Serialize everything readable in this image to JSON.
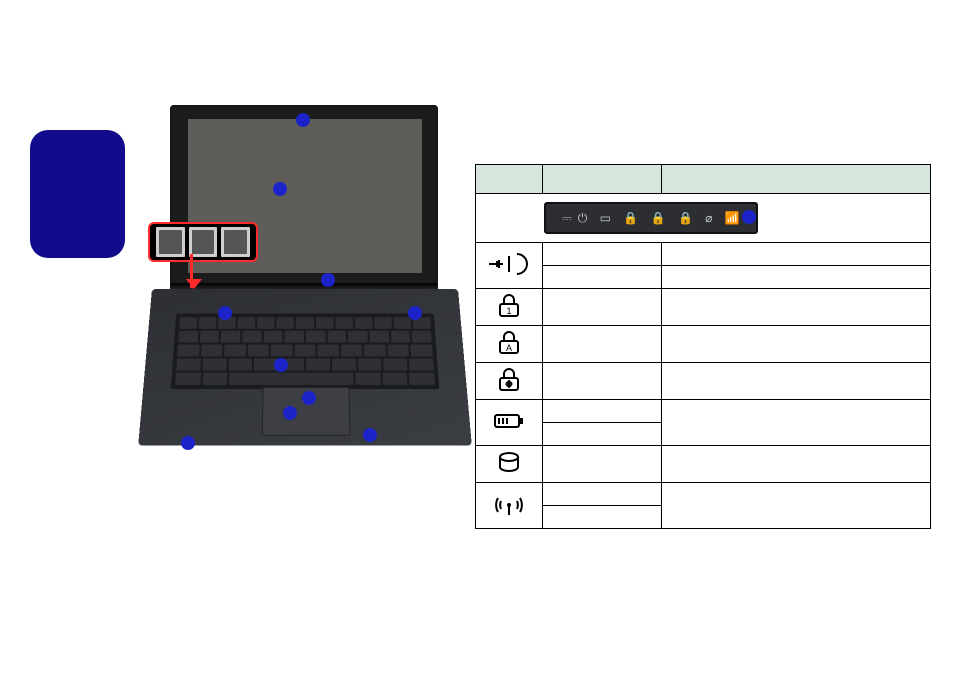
{
  "blue_card": {},
  "laptop_callouts": [
    "camera",
    "display",
    "led-panel-area",
    "power-button",
    "hotkey-area",
    "keyboard-area",
    "touchpad",
    "click-buttons",
    "palmrest"
  ],
  "hotkey_inset": {
    "buttons": [
      "hk-1",
      "hk-2",
      "hk-3"
    ]
  },
  "led_strip_icons": [
    "ac-power-icon",
    "power-icon",
    "battery-icon",
    "numlock-icon",
    "capslock-icon",
    "scrolllock-icon",
    "hdd-icon",
    "wireless-icon"
  ],
  "led_table": {
    "headers": [
      "",
      "",
      ""
    ],
    "rows": [
      {
        "icon": "ac-power-combo-icon",
        "col1": [
          "",
          ""
        ],
        "col2": [
          "",
          ""
        ]
      },
      {
        "icon": "numlock-icon",
        "col1": [
          ""
        ],
        "col2": [
          ""
        ]
      },
      {
        "icon": "capslock-icon",
        "col1": [
          ""
        ],
        "col2": [
          ""
        ]
      },
      {
        "icon": "scrolllock-icon",
        "col1": [
          ""
        ],
        "col2": [
          ""
        ]
      },
      {
        "icon": "battery-icon",
        "col1": [
          "",
          ""
        ],
        "col2": [
          ""
        ]
      },
      {
        "icon": "hdd-icon",
        "col1": [
          ""
        ],
        "col2": [
          ""
        ]
      },
      {
        "icon": "wireless-icon",
        "col1": [
          "",
          ""
        ],
        "col2": [
          ""
        ]
      }
    ]
  }
}
